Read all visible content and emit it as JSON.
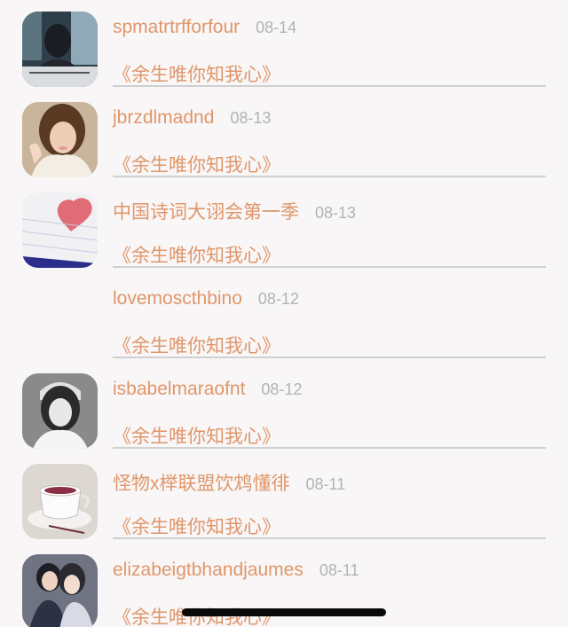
{
  "posts": [
    {
      "user": "spmatrtrfforfour",
      "date": "08-14",
      "content": "《余生唯你知我心》",
      "avatar": "person-at-window-icon"
    },
    {
      "user": "jbrzdlmadnd",
      "date": "08-13",
      "content": "《余生唯你知我心》",
      "avatar": "smiling-woman-icon"
    },
    {
      "user": "中国诗词大诩会第一季",
      "date": "08-13",
      "content": "《余生唯你知我心》",
      "avatar": "heart-notebook-icon"
    },
    {
      "user": "lovemoscthbino",
      "date": "08-12",
      "content": "《余生唯你知我心》",
      "avatar": "blank-avatar"
    },
    {
      "user": "isbabelmaraofnt",
      "date": "08-12",
      "content": "《余生唯你知我心》",
      "avatar": "bw-portrait-icon"
    },
    {
      "user": "怪物x榉联盟饮鸩懂徘",
      "date": "08-11",
      "content": "《余生唯你知我心》",
      "avatar": "coffee-cup-icon"
    },
    {
      "user": "elizabeigtbhandjaumes",
      "date": "08-11",
      "content": "《余生唯你知我心》",
      "avatar": "couple-photo-icon"
    }
  ],
  "colors": {
    "accent": "#e0966a",
    "date": "#b3b3b3",
    "divider": "#d0d0d0",
    "background": "#f8f6f7"
  }
}
